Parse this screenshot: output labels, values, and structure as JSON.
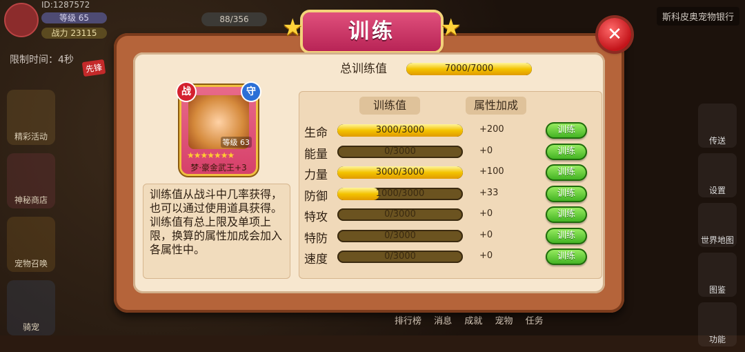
{
  "player": {
    "id_text": "ID:1287572",
    "level_text": "等级 65",
    "power_text": "战力 23115",
    "time_limit": "限制时间：4秒"
  },
  "hud": {
    "stamina": "88/356",
    "bank": "斯科皮奥宠物银行",
    "side_tag": "先锋"
  },
  "left_menu": [
    "精彩活动",
    "神秘商店",
    "宠物召唤",
    "骑宠"
  ],
  "right_menu": [
    "传送",
    "设置",
    "世界地图",
    "图鉴",
    "功能"
  ],
  "bottom_tabs": [
    "排行榜",
    "消息",
    "成就",
    "宠物",
    "任务"
  ],
  "dialog": {
    "title": "训练",
    "close": "✕",
    "total_label": "总训练值",
    "total_value": "7000/7000",
    "total_fraction": 1.0,
    "col_train": "训练值",
    "col_bonus": "属性加成",
    "train_button": "训练",
    "description": "训练值从战斗中几率获得，也可以通过使用道具获得。训练值有总上限及单项上限，换算的属性加成会加入各属性中。"
  },
  "pet_card": {
    "type_badge": "战",
    "role_badge": "守",
    "level": "等级 63",
    "stars": "★★★★★★★",
    "name": "梦·豪金武王+3"
  },
  "stats": [
    {
      "name": "生命",
      "value": "3000/3000",
      "fraction": 1.0,
      "bonus": "+200"
    },
    {
      "name": "能量",
      "value": "0/3000",
      "fraction": 0.0,
      "bonus": "+0"
    },
    {
      "name": "力量",
      "value": "3000/3000",
      "fraction": 1.0,
      "bonus": "+100"
    },
    {
      "name": "防御",
      "value": "1000/3000",
      "fraction": 0.333,
      "bonus": "+33"
    },
    {
      "name": "特攻",
      "value": "0/3000",
      "fraction": 0.0,
      "bonus": "+0"
    },
    {
      "name": "特防",
      "value": "0/3000",
      "fraction": 0.0,
      "bonus": "+0"
    },
    {
      "name": "速度",
      "value": "0/3000",
      "fraction": 0.0,
      "bonus": "+0"
    }
  ]
}
